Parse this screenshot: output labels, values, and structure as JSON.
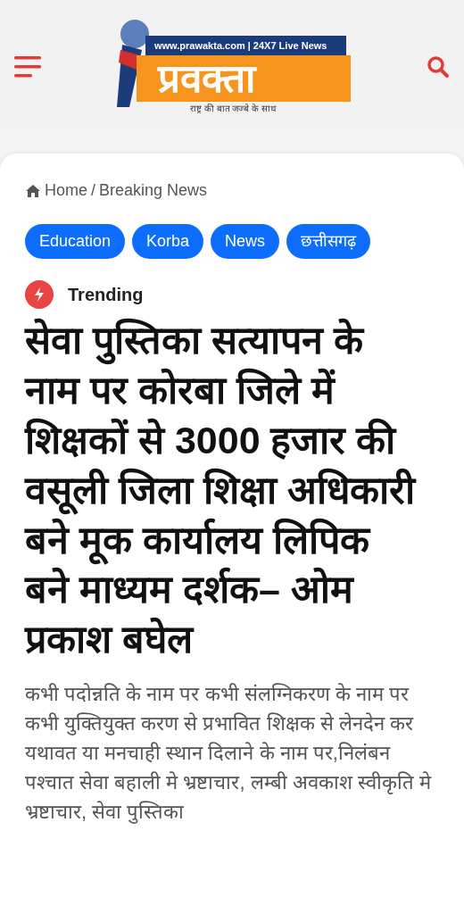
{
  "header": {
    "logo": {
      "url_line": "www.prawakta.com | 24X7 Live News",
      "name": "प्रवक्ता",
      "tagline": "राष्ट्र की बात जज्बे के साथ"
    }
  },
  "breadcrumb": [
    {
      "label": "Home",
      "kind": "home"
    },
    {
      "label": "/",
      "kind": "separator"
    },
    {
      "label": "Breaking News",
      "kind": "current"
    }
  ],
  "tags": [
    "Education",
    "Korba",
    "News",
    "छत्तीसगढ़"
  ],
  "badge": {
    "label": "Trending"
  },
  "headline": "सेवा पुस्तिका सत्यापन के नाम पर कोरबा जिले में शिक्षकों से 3000 हजार की वसूली जिला शिक्षा अधिकारी बने मूक कार्यालय लिपिक बने माध्यम दर्शक– ओम प्रकाश बघेल",
  "excerpt": "कभी पदोन्नति के नाम पर कभी संलग्निकरण के नाम पर कभी युक्तियुक्त करण से प्रभावित शिक्षक से लेनदेन कर यथावत या मनचाही स्थान दिलाने के नाम पर,निलंबन पश्चात सेवा बहाली मे भ्रष्टाचार, लम्बी अवकाश स्वीकृति मे भ्रष्टाचार, सेवा पुस्तिका"
}
